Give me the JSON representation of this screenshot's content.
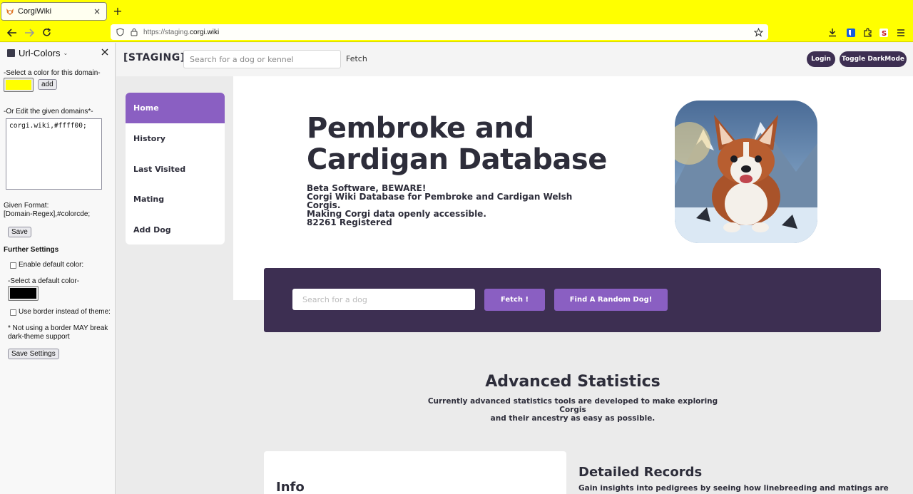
{
  "browser": {
    "tab": {
      "title": "CorgiWiki",
      "close": "×"
    },
    "new_tab": "+",
    "url": {
      "prefix": "https://staging.",
      "domain": "corgi.wiki"
    }
  },
  "colors": {
    "browser_theme": "#ffff00",
    "accent_purple": "#8a5fc2",
    "dark_purple": "#3d2f52",
    "text_dark": "#2d2d3a"
  },
  "sidebar": {
    "title": "Url-Colors",
    "caret": "⌄",
    "select_color_label": "-Select a color for this domain-",
    "domain_color": "#ffff00",
    "add_label": "add",
    "edit_domains_label": "-Or Edit the given domains*-",
    "domains_text": "corgi.wiki,#ffff00;",
    "format_label": "Given Format:",
    "format_value": "[Domain-Regex],#colorcde;",
    "save_label": "Save",
    "further_settings": "Further Settings",
    "enable_default_label": "Enable default color:",
    "select_default_label": "-Select a default color-",
    "default_color": "#000000",
    "use_border_label": "Use border instead of theme:",
    "note_line1": "* Not using a border MAY break",
    "note_line2": "dark-theme support",
    "save_settings_label": "Save Settings"
  },
  "site": {
    "brand": "[STAGING]",
    "top_search_placeholder": "Search for a dog or kennel",
    "top_fetch": "Fetch",
    "login": "Login",
    "toggle_darkmode": "Toggle DarkMode",
    "menu": [
      {
        "label": "Home",
        "active": true
      },
      {
        "label": "History"
      },
      {
        "label": "Last Visited"
      },
      {
        "label": "Mating"
      },
      {
        "label": "Add Dog"
      }
    ],
    "hero": {
      "title": "Pembroke and Cardigan Database",
      "lines": [
        "Beta Software, BEWARE!",
        "Corgi Wiki Database for Pembroke and Cardigan Welsh Corgis.",
        "Making Corgi data openly accessible.",
        "82261 Registered"
      ]
    },
    "search_band": {
      "placeholder": "Search for a dog",
      "fetch": "Fetch !",
      "random": "Find A Random Dog!"
    },
    "advanced": {
      "title": "Advanced Statistics",
      "line1": "Currently advanced statistics tools are developed to make exploring Corgis",
      "line2": "and their ancestry as easy as possible."
    },
    "info_title": "Info",
    "detailed_title": "Detailed Records",
    "detailed_text": "Gain insights into pedigrees by seeing how linebreeding and matings are"
  }
}
